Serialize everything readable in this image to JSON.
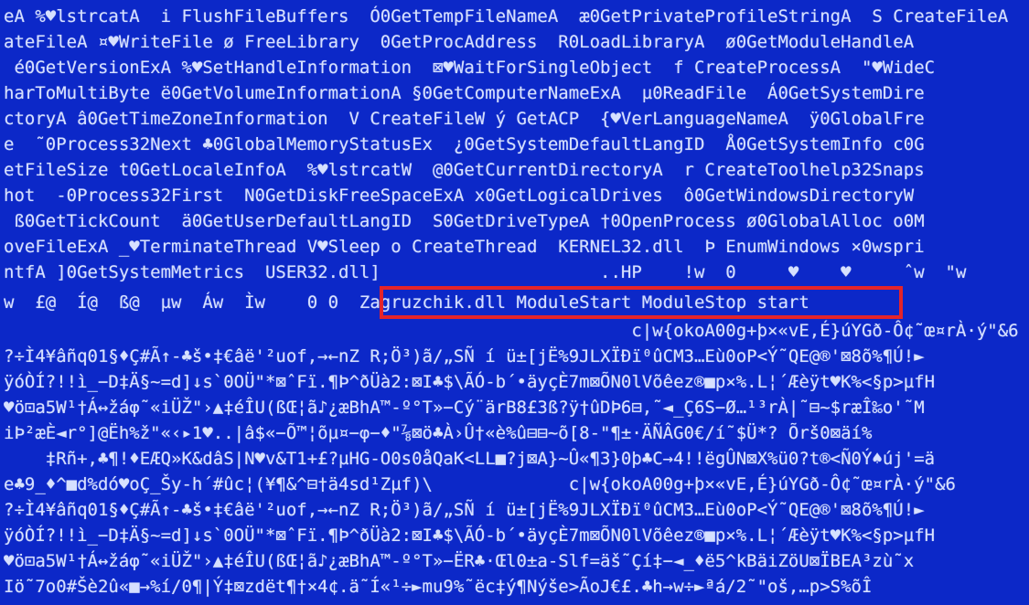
{
  "window": {
    "background": "#0c28c8",
    "text_color": "#d6e0ff",
    "highlight_color": "#e4242a"
  },
  "hex_dump": {
    "lines": [
      "eA %♥lstrcatA  i FlushFileBuffers  Ó0GetTempFileNameA  æ0GetPrivateProfileStringA  S CreateFileA",
      "ateFileA ¤♥WriteFile ø FreeLibrary  0GetProcAddress  R0LoadLibraryA  ø0GetModuleHandleA  ",
      " é0GetVersionExA %♥SetHandleInformation  ⊠♥WaitForSingleObject  f CreateProcessA  \"♥WideC",
      "harToMultiByte ë0GetVolumeInformationA §0GetComputerNameExA  µ0ReadFile  Á0GetSystemDire",
      "ctoryA â0GetTimeZoneInformation  V CreateFileW ý GetACP  {♥VerLanguageNameA  ÿ0GlobalFre",
      "e  ˜0Process32Next ♣0GlobalMemoryStatusEx  ¿0GetSystemDefaultLangID  Å0GetSystemInfo c0G",
      "etFileSize t0GetLocaleInfoA  %♥lstrcatW  @0GetCurrentDirectoryA  r CreateToolhelp32Snaps",
      "hot  -0Process32First  N0GetDiskFreeSpaceExA x0GetLogicalDrives  ô0GetWindowsDirectoryW",
      " ß0GetTickCount  ä0GetUserDefaultLangID  S0GetDriveTypeA †0OpenProcess ø0GlobalAlloc o0M",
      "oveFileExA _♥TerminateThread V♥Sleep o CreateThread  KERNEL32.dll  Þ EnumWindows ×0wspri",
      "ntfA ]0GetSystemMetrics  USER32.dll]                     ..HP    !w  0     ♥    ♥     ˆw  \"w",
      "w  £@  Í@  ß@  µw  Áw  Ìw    0 0  Zagruzchik.dll ModuleStart ModuleStop start",
      "                                                            c|w{okoA00g+þ×«vE,É}úYGð-Ô¢˜œ¤rÀ·ý\"&6",
      "?÷Ì4¥âñq01§♦Ç#Ã↑-♣š•‡€âë'²uof,→←nZ R;Ö³)ã/„SÑ í ü±[jË%9JLXÏÐï⁰ûCM3…Eù0oP<Ý˜QE@®'⊠8õ%¶Ú!►",
      "ÿóÒÍ?!!ì_−D‡Ä§~=d]↓s`0OÜ\"*⊠ˆFï.¶Þ^ðÜà2:⊠I♣$\\ÃÓ-b´•äyçÈ7m⊠ÕN0lVõêez®■p×%.L¦´Æèÿt♥K%<§p>µfH",
      "♥ö⊡a5W¹†Á↔žáφ˜«iÜŽ\"›▲‡éÎU(ßŒ¦ã♪¿æBhA™-º°T»−Cý¨ärB8£3ß?ÿ†ûDÞ6⊟,˜◄_Ç6S−Ø…¹³rÀ|˜⊟~$ræÎ‰o'˜M",
      "iÞ²æÈ◄r°]@Ëh%ž\"«‹▸1♥..|â$«−Õ™¦õµ¤−φ−♦\"⅞⊠ö♣À›Û†«è%û⊟⊟~õ[8-\"¶±·ÄÑÂG0€/í˜$Ü*? Õrš0⊠äí%",
      "    ‡Rñ+,♣¶!♦EÆQ»K&dâS|N♥v&T1+£?µHG-O0s0åQaK<LL■?j⊠A}~Û«¶3}0þ♣C→4!!ëgÛN⊠X%ü0?t®<Ñ0Ý♠új'=ä",
      "e♣9_♦^■d%dó♥oÇ_Šy-h´#ûc¦(¥¶&^⊟†ä4sd¹Zµf)\\             c|w{okoA00g+þ×«vE,É}úYGð-Ô¢˜œ¤rÀ·ý\"&6",
      "?÷Ì4¥âñq01§♦Ç#Ã↑-♣š•‡€âë'²uof,→←nZ R;Ö³)ã/„SÑ í ü±[jË%9JLXÏÐï⁰ûCM3…Eù0oP<Ý˜QE@®'⊠8õ%¶Ú!►",
      "ÿóÒÍ?!!ì_−D‡Ä§~=d]↓s`0OÜ\"*⊠ˆFï.¶Þ^ðÜà2:⊠I♣$\\ÃÓ-b´•äyçÈ7m⊠ÕN0lVõêez®■p×%.L¦´Æèÿt♥K%<§p>µfH",
      "♥ö⊡a5W¹†Á↔žáφ˜«iÜŽ\"›▲‡éÎU(ßŒ¦ã♪¿æBhA™-º°T»−ËR♣·Œl0±a-Slf=äš˜Çí‡−◄_♦ë5^kBäiZöU⊠ÏBEA³zù˜x",
      "Iö˜7o0#Šè2û«■→%í/0¶|Ý‡⊠zdët¶†×4¢.ä˜Í«¹÷►mu9%˜ëc‡ý¶Nýše>ÃoJ€£.♣h→w÷►ªá/2˜\"oš,…p>S%õÎ"
    ],
    "highlighted_text": "Zagruzchik.dll ModuleStart ModuleStop start"
  }
}
